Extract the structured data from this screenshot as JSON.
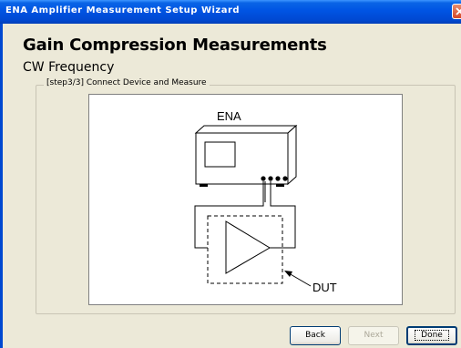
{
  "window": {
    "title": "ENA Amplifier Measurement Setup Wizard",
    "close_icon": "close-icon"
  },
  "page": {
    "heading": "Gain Compression Measurements",
    "subheading": "CW Frequency",
    "step_label": "[step3/3] Connect Device and Measure"
  },
  "diagram": {
    "instrument_label": "ENA",
    "dut_label": "DUT"
  },
  "buttons": {
    "back": "Back",
    "next": "Next",
    "done": "Done"
  }
}
